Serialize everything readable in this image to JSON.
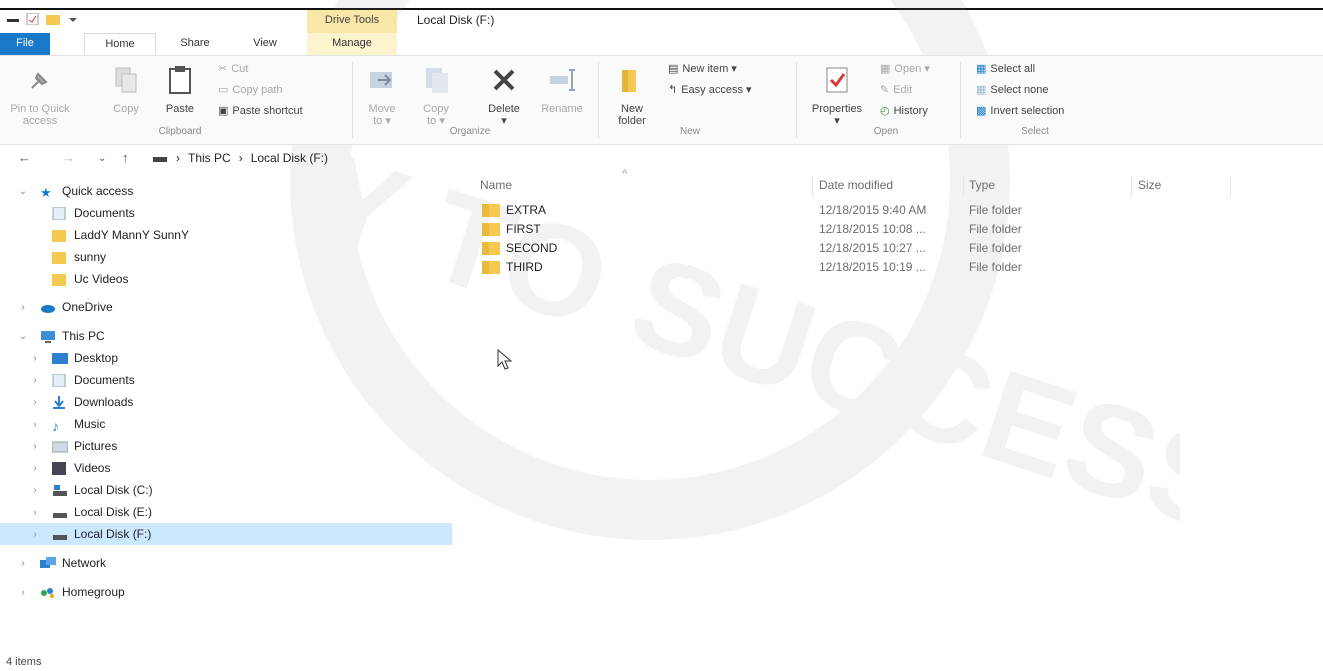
{
  "titlebar": {
    "contextual_tab": "Drive Tools",
    "window_title": "Local Disk (F:)"
  },
  "tabs": [
    {
      "label": "File"
    },
    {
      "label": "Home"
    },
    {
      "label": "Share"
    },
    {
      "label": "View"
    },
    {
      "label": "Manage"
    }
  ],
  "ribbon": {
    "clipboard": {
      "pin_line1": "Pin to Quick",
      "pin_line2": "access",
      "copy": "Copy",
      "paste": "Paste",
      "cut": "Cut",
      "copy_path": "Copy path",
      "paste_shortcut": "Paste shortcut",
      "group": "Clipboard"
    },
    "organize": {
      "move_line1": "Move",
      "move_line2": "to ▾",
      "copy_line1": "Copy",
      "copy_line2": "to ▾",
      "delete": "Delete",
      "delete_arrow": "▾",
      "rename": "Rename",
      "group": "Organize"
    },
    "new": {
      "new_item": "New item ▾",
      "easy_access": "Easy access ▾",
      "folder_line1": "New",
      "folder_line2": "folder",
      "group": "New"
    },
    "open": {
      "properties": "Properties",
      "properties_arrow": "▾",
      "open": "Open ▾",
      "edit": "Edit",
      "history": "History",
      "group": "Open"
    },
    "select": {
      "select_all": "Select all",
      "select_none": "Select none",
      "invert": "Invert selection",
      "group": "Select"
    }
  },
  "address": {
    "crumbs": [
      "This PC",
      "Local Disk (F:)"
    ],
    "separator": "›"
  },
  "nav": {
    "quick_access": "Quick access",
    "quick_items": [
      "Documents",
      "LaddY MannY SunnY",
      "sunny",
      "Uc Videos"
    ],
    "onedrive": "OneDrive",
    "this_pc": "This PC",
    "pc_items": [
      "Desktop",
      "Documents",
      "Downloads",
      "Music",
      "Pictures",
      "Videos",
      "Local Disk (C:)",
      "Local Disk (E:)",
      "Local Disk (F:)"
    ],
    "network": "Network",
    "homegroup": "Homegroup"
  },
  "columns": {
    "name": "Name",
    "date": "Date modified",
    "type": "Type",
    "size": "Size",
    "sort_arrow": "^"
  },
  "files": [
    {
      "name": "EXTRA",
      "date": "12/18/2015 9:40 AM",
      "type": "File folder"
    },
    {
      "name": "FIRST",
      "date": "12/18/2015 10:08 ...",
      "type": "File folder"
    },
    {
      "name": "SECOND",
      "date": "12/18/2015 10:27 ...",
      "type": "File folder"
    },
    {
      "name": "THIRD",
      "date": "12/18/2015 10:19 ...",
      "type": "File folder"
    }
  ],
  "status": {
    "items": "4 items"
  },
  "watermark": {
    "line1": "Y TO SUCCESS"
  },
  "colors": {
    "accent": "#1979ca",
    "selection": "#cce8ff",
    "folder": "#f3c94f",
    "drive_tools": "#f9e7a7"
  }
}
